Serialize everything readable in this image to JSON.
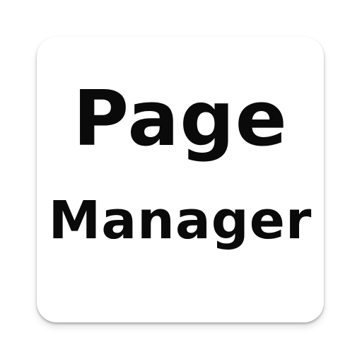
{
  "icon": {
    "line1": "Page",
    "line2": "Manager"
  }
}
